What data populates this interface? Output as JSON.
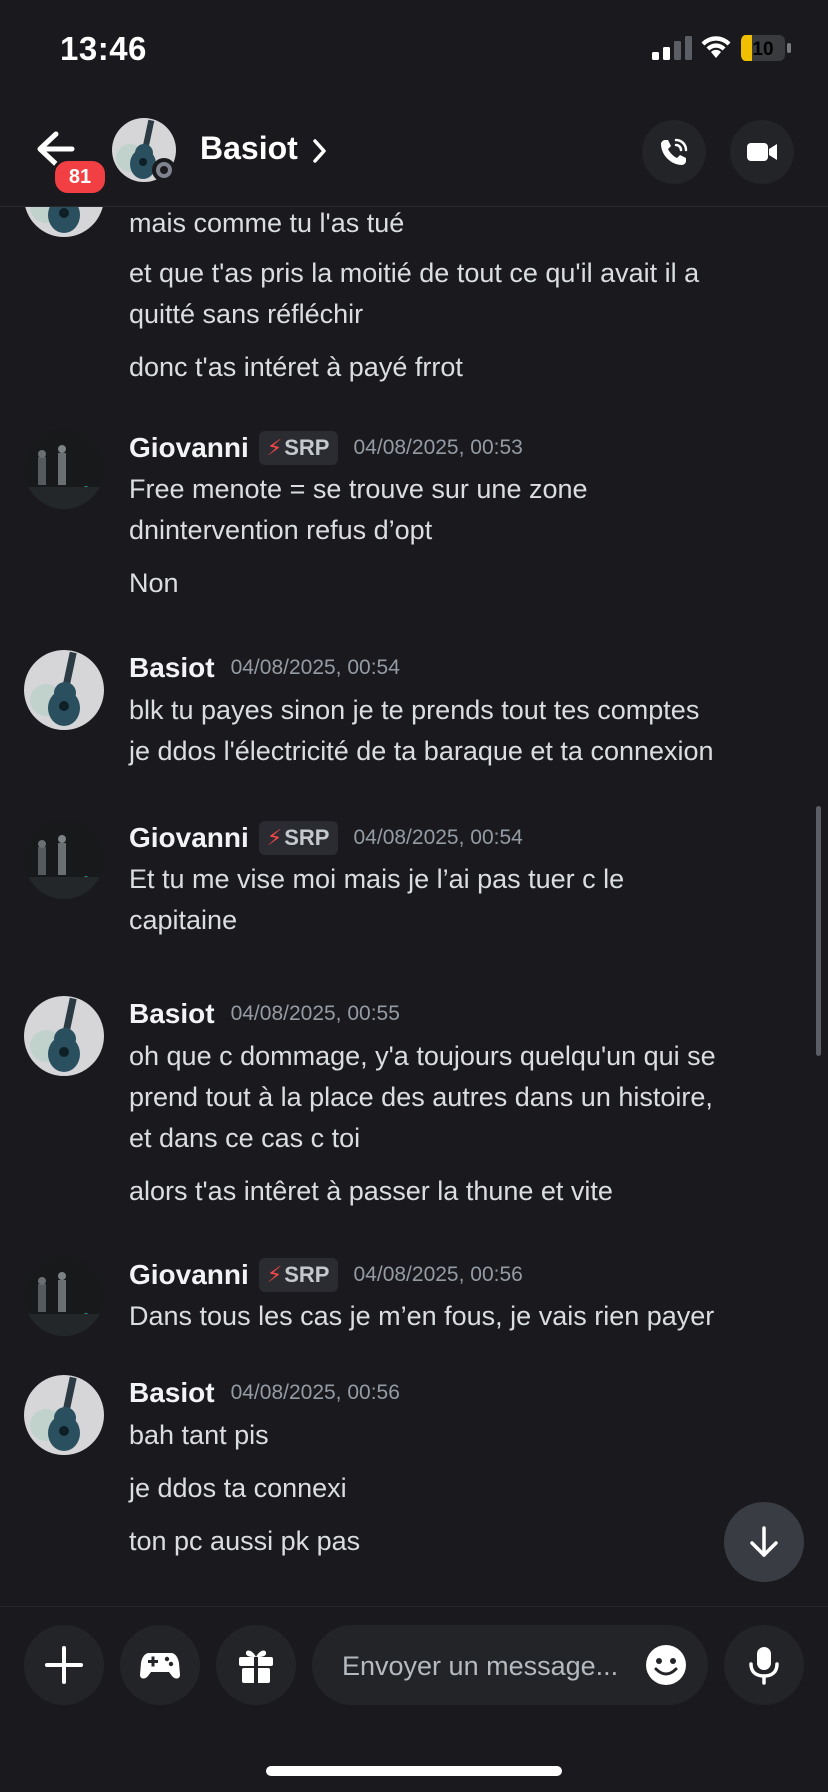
{
  "status_bar": {
    "time": "13:46",
    "battery": "10"
  },
  "header": {
    "unread_count": "81",
    "username": "Basiot",
    "chevron": "›"
  },
  "composer": {
    "placeholder": "Envoyer un message..."
  },
  "colors": {
    "background": "#1a1a1e",
    "badge_red": "#f23f43",
    "battery_yellow": "#f0c000",
    "text": "#dbdee1",
    "timestamp": "#949ba4"
  },
  "icons": [
    "signal-icon",
    "wifi-icon",
    "battery-icon",
    "back-arrow-icon",
    "chevron-right-icon",
    "phone-call-icon",
    "video-camera-icon",
    "plus-icon",
    "gamepad-icon",
    "gift-icon",
    "emoji-icon",
    "microphone-icon",
    "arrow-down-icon"
  ],
  "messages": [
    {
      "author": "",
      "lines": [
        "mais comme tu l'as tué",
        "et que t'as pris la moitié de tout ce qu'il avait il a",
        "quitté sans réfléchir",
        "donc t'as intéret à payé frrot"
      ]
    },
    {
      "author": "Giovanni",
      "tag": "SRP",
      "tag_icon": "⚡",
      "timestamp": "04/08/2025, 00:53",
      "lines": [
        "Free menote = se trouve sur une zone",
        "dnintervention refus d’opt",
        "Non"
      ]
    },
    {
      "author": "Basiot",
      "timestamp": "04/08/2025, 00:54",
      "lines": [
        "blk tu payes sinon je te prends tout tes comptes",
        "je ddos l'électricité de ta baraque et ta connexion"
      ]
    },
    {
      "author": "Giovanni",
      "tag": "SRP",
      "tag_icon": "⚡",
      "timestamp": "04/08/2025, 00:54",
      "lines": [
        "Et tu me vise moi mais je l’ai pas tuer c le",
        "capitaine"
      ]
    },
    {
      "author": "Basiot",
      "timestamp": "04/08/2025, 00:55",
      "lines": [
        "oh que c dommage, y'a toujours quelqu'un qui se",
        "prend tout à la place des autres dans un histoire,",
        "et dans ce cas c toi",
        "alors t'as intêret à passer la thune et vite"
      ]
    },
    {
      "author": "Giovanni",
      "tag": "SRP",
      "tag_icon": "⚡",
      "timestamp": "04/08/2025, 00:56",
      "lines": [
        "Dans tous les cas je m’en fous, je vais rien payer"
      ]
    },
    {
      "author": "Basiot",
      "timestamp": "04/08/2025, 00:56",
      "lines": [
        "bah tant pis",
        "je ddos ta connexi",
        "ton pc aussi pk pas"
      ]
    }
  ]
}
